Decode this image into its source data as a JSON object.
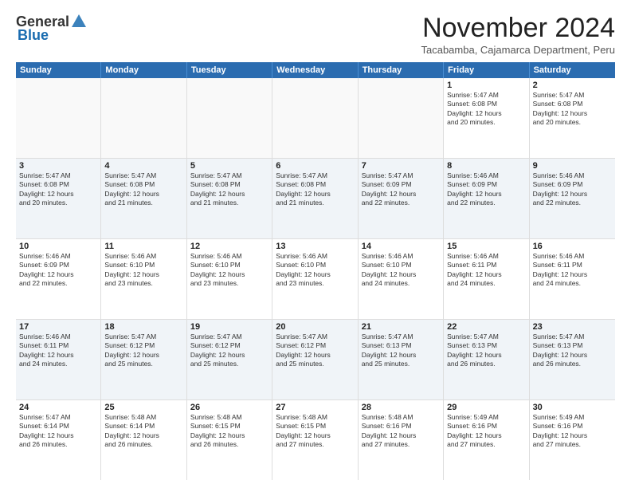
{
  "logo": {
    "general": "General",
    "blue": "Blue"
  },
  "title": "November 2024",
  "subtitle": "Tacabamba, Cajamarca Department, Peru",
  "header_days": [
    "Sunday",
    "Monday",
    "Tuesday",
    "Wednesday",
    "Thursday",
    "Friday",
    "Saturday"
  ],
  "rows": [
    [
      {
        "day": "",
        "empty": true
      },
      {
        "day": "",
        "empty": true
      },
      {
        "day": "",
        "empty": true
      },
      {
        "day": "",
        "empty": true
      },
      {
        "day": "",
        "empty": true
      },
      {
        "day": "1",
        "lines": [
          "Sunrise: 5:47 AM",
          "Sunset: 6:08 PM",
          "Daylight: 12 hours",
          "and 20 minutes."
        ]
      },
      {
        "day": "2",
        "lines": [
          "Sunrise: 5:47 AM",
          "Sunset: 6:08 PM",
          "Daylight: 12 hours",
          "and 20 minutes."
        ]
      }
    ],
    [
      {
        "day": "3",
        "lines": [
          "Sunrise: 5:47 AM",
          "Sunset: 6:08 PM",
          "Daylight: 12 hours",
          "and 20 minutes."
        ]
      },
      {
        "day": "4",
        "lines": [
          "Sunrise: 5:47 AM",
          "Sunset: 6:08 PM",
          "Daylight: 12 hours",
          "and 21 minutes."
        ]
      },
      {
        "day": "5",
        "lines": [
          "Sunrise: 5:47 AM",
          "Sunset: 6:08 PM",
          "Daylight: 12 hours",
          "and 21 minutes."
        ]
      },
      {
        "day": "6",
        "lines": [
          "Sunrise: 5:47 AM",
          "Sunset: 6:08 PM",
          "Daylight: 12 hours",
          "and 21 minutes."
        ]
      },
      {
        "day": "7",
        "lines": [
          "Sunrise: 5:47 AM",
          "Sunset: 6:09 PM",
          "Daylight: 12 hours",
          "and 22 minutes."
        ]
      },
      {
        "day": "8",
        "lines": [
          "Sunrise: 5:46 AM",
          "Sunset: 6:09 PM",
          "Daylight: 12 hours",
          "and 22 minutes."
        ]
      },
      {
        "day": "9",
        "lines": [
          "Sunrise: 5:46 AM",
          "Sunset: 6:09 PM",
          "Daylight: 12 hours",
          "and 22 minutes."
        ]
      }
    ],
    [
      {
        "day": "10",
        "lines": [
          "Sunrise: 5:46 AM",
          "Sunset: 6:09 PM",
          "Daylight: 12 hours",
          "and 22 minutes."
        ]
      },
      {
        "day": "11",
        "lines": [
          "Sunrise: 5:46 AM",
          "Sunset: 6:10 PM",
          "Daylight: 12 hours",
          "and 23 minutes."
        ]
      },
      {
        "day": "12",
        "lines": [
          "Sunrise: 5:46 AM",
          "Sunset: 6:10 PM",
          "Daylight: 12 hours",
          "and 23 minutes."
        ]
      },
      {
        "day": "13",
        "lines": [
          "Sunrise: 5:46 AM",
          "Sunset: 6:10 PM",
          "Daylight: 12 hours",
          "and 23 minutes."
        ]
      },
      {
        "day": "14",
        "lines": [
          "Sunrise: 5:46 AM",
          "Sunset: 6:10 PM",
          "Daylight: 12 hours",
          "and 24 minutes."
        ]
      },
      {
        "day": "15",
        "lines": [
          "Sunrise: 5:46 AM",
          "Sunset: 6:11 PM",
          "Daylight: 12 hours",
          "and 24 minutes."
        ]
      },
      {
        "day": "16",
        "lines": [
          "Sunrise: 5:46 AM",
          "Sunset: 6:11 PM",
          "Daylight: 12 hours",
          "and 24 minutes."
        ]
      }
    ],
    [
      {
        "day": "17",
        "lines": [
          "Sunrise: 5:46 AM",
          "Sunset: 6:11 PM",
          "Daylight: 12 hours",
          "and 24 minutes."
        ]
      },
      {
        "day": "18",
        "lines": [
          "Sunrise: 5:47 AM",
          "Sunset: 6:12 PM",
          "Daylight: 12 hours",
          "and 25 minutes."
        ]
      },
      {
        "day": "19",
        "lines": [
          "Sunrise: 5:47 AM",
          "Sunset: 6:12 PM",
          "Daylight: 12 hours",
          "and 25 minutes."
        ]
      },
      {
        "day": "20",
        "lines": [
          "Sunrise: 5:47 AM",
          "Sunset: 6:12 PM",
          "Daylight: 12 hours",
          "and 25 minutes."
        ]
      },
      {
        "day": "21",
        "lines": [
          "Sunrise: 5:47 AM",
          "Sunset: 6:13 PM",
          "Daylight: 12 hours",
          "and 25 minutes."
        ]
      },
      {
        "day": "22",
        "lines": [
          "Sunrise: 5:47 AM",
          "Sunset: 6:13 PM",
          "Daylight: 12 hours",
          "and 26 minutes."
        ]
      },
      {
        "day": "23",
        "lines": [
          "Sunrise: 5:47 AM",
          "Sunset: 6:13 PM",
          "Daylight: 12 hours",
          "and 26 minutes."
        ]
      }
    ],
    [
      {
        "day": "24",
        "lines": [
          "Sunrise: 5:47 AM",
          "Sunset: 6:14 PM",
          "Daylight: 12 hours",
          "and 26 minutes."
        ]
      },
      {
        "day": "25",
        "lines": [
          "Sunrise: 5:48 AM",
          "Sunset: 6:14 PM",
          "Daylight: 12 hours",
          "and 26 minutes."
        ]
      },
      {
        "day": "26",
        "lines": [
          "Sunrise: 5:48 AM",
          "Sunset: 6:15 PM",
          "Daylight: 12 hours",
          "and 26 minutes."
        ]
      },
      {
        "day": "27",
        "lines": [
          "Sunrise: 5:48 AM",
          "Sunset: 6:15 PM",
          "Daylight: 12 hours",
          "and 27 minutes."
        ]
      },
      {
        "day": "28",
        "lines": [
          "Sunrise: 5:48 AM",
          "Sunset: 6:16 PM",
          "Daylight: 12 hours",
          "and 27 minutes."
        ]
      },
      {
        "day": "29",
        "lines": [
          "Sunrise: 5:49 AM",
          "Sunset: 6:16 PM",
          "Daylight: 12 hours",
          "and 27 minutes."
        ]
      },
      {
        "day": "30",
        "lines": [
          "Sunrise: 5:49 AM",
          "Sunset: 6:16 PM",
          "Daylight: 12 hours",
          "and 27 minutes."
        ]
      }
    ]
  ]
}
